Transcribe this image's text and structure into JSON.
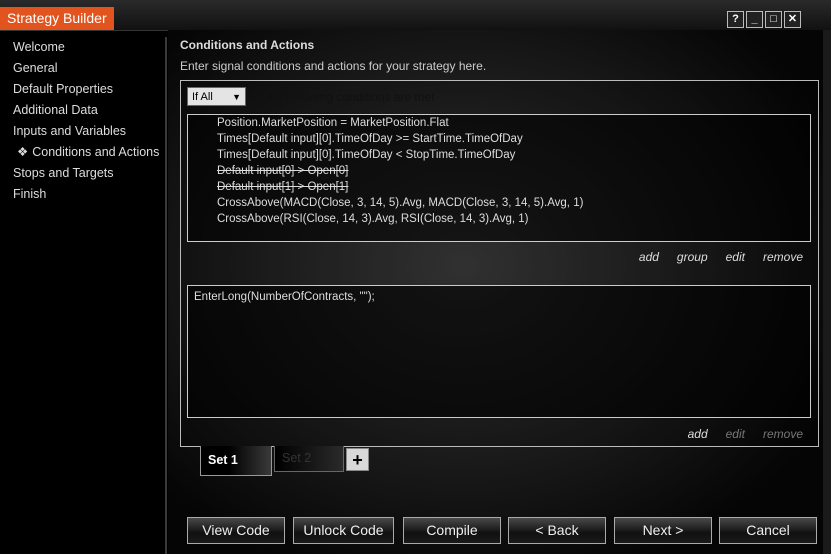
{
  "window": {
    "title": "Strategy Builder",
    "buttons": [
      {
        "label": "?",
        "icon": "help-icon"
      },
      {
        "label": "_",
        "icon": "minimize-icon"
      },
      {
        "label": "□",
        "icon": "maximize-icon"
      },
      {
        "label": "✕",
        "icon": "close-icon"
      }
    ]
  },
  "sidebar": {
    "items": [
      {
        "label": "Welcome"
      },
      {
        "label": "General"
      },
      {
        "label": "Default Properties"
      },
      {
        "label": "Additional Data"
      },
      {
        "label": "Inputs and Variables"
      },
      {
        "label": "Conditions and Actions",
        "active": true
      },
      {
        "label": "Stops and Targets"
      },
      {
        "label": "Finish"
      }
    ],
    "active_marker": "❖"
  },
  "main": {
    "heading": "Conditions and Actions",
    "subtitle": "Enter signal conditions and actions for your strategy here.",
    "condition_select": "If All",
    "condition_suffix": "of the following conditions are met",
    "conditions": [
      "Position.MarketPosition = MarketPosition.Flat",
      "Times[Default input][0].TimeOfDay >= StartTime.TimeOfDay",
      "Times[Default input][0].TimeOfDay < StopTime.TimeOfDay",
      "Default input[0] > Open[0]",
      "Default input[1] > Open[1]",
      "CrossAbove(MACD(Close, 3, 14, 5).Avg, MACD(Close, 3, 14, 5).Avg, 1)",
      "CrossAbove(RSI(Close, 14, 3).Avg, RSI(Close, 14, 3).Avg, 1)"
    ],
    "condition_links": [
      "add",
      "group",
      "edit",
      "remove"
    ],
    "actions": [
      "EnterLong(NumberOfContracts, \"\");"
    ],
    "action_links": [
      {
        "label": "add",
        "enabled": true
      },
      {
        "label": "edit",
        "enabled": false
      },
      {
        "label": "remove",
        "enabled": false
      }
    ],
    "tabs": [
      {
        "label": "Set 1",
        "active": true
      },
      {
        "label": "Set 2",
        "active": false
      }
    ],
    "add_tab_label": "+"
  },
  "footer_buttons": [
    "View Code",
    "Unlock Code",
    "Compile",
    "< Back",
    "Next >",
    "Cancel"
  ],
  "colors": {
    "accent": "#e2541e",
    "background": "#000000"
  }
}
